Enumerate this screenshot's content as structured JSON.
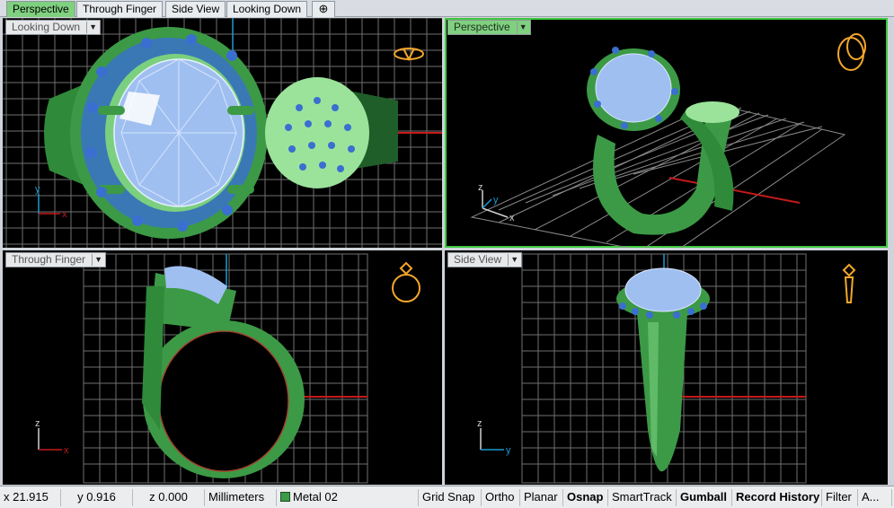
{
  "tabs": [
    {
      "label": "Perspective"
    },
    {
      "label": "Through Finger"
    },
    {
      "label": "Side View"
    },
    {
      "label": "Looking Down"
    }
  ],
  "add_tab_icon": "plus-icon",
  "viewports": {
    "top_left": {
      "title": "Looking Down",
      "axis_h": "x",
      "axis_v": "y"
    },
    "top_right": {
      "title": "Perspective",
      "axis_x": "x",
      "axis_y": "y",
      "axis_z": "z"
    },
    "bottom_left": {
      "title": "Through Finger",
      "axis_h": "x",
      "axis_v": "z"
    },
    "bottom_right": {
      "title": "Side View",
      "axis_h": "y",
      "axis_v": "z"
    }
  },
  "status": {
    "x": "x 21.915",
    "y": "y 0.916",
    "z": "z 0.000",
    "units": "Millimeters",
    "layer": "Metal 02",
    "toggles": [
      "Grid Snap",
      "Ortho",
      "Planar",
      "Osnap",
      "SmartTrack",
      "Gumball",
      "Record History",
      "Filter",
      "A..."
    ]
  },
  "colors": {
    "metal": "#3c9a46",
    "stone": "#9fbff0",
    "accent_stone": "#3a6fd1",
    "grid": "#8a8a8a",
    "x_axis": "#c41a1a",
    "y_axis": "#1a9ad1",
    "active_tab": "#7fd07f"
  }
}
